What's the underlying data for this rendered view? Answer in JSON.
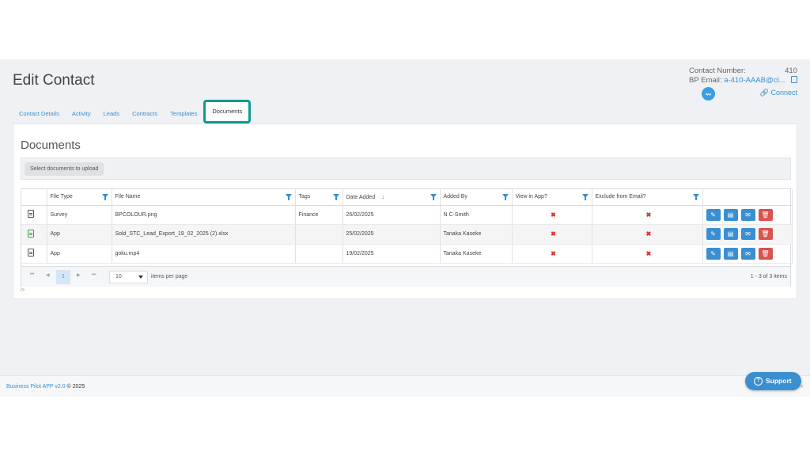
{
  "page": {
    "title": "Edit Contact"
  },
  "contact": {
    "number_label": "Contact Number:",
    "number_value": "410",
    "email_label": "BP Email:",
    "email_value": "a-410-AAAB@cl...",
    "badge": "app",
    "connect_label": "Connect"
  },
  "tabs": [
    {
      "label": "Contact Details"
    },
    {
      "label": "Activity"
    },
    {
      "label": "Leads"
    },
    {
      "label": "Contracts"
    },
    {
      "label": "Templates"
    },
    {
      "label": "Documents",
      "active": true
    }
  ],
  "documents": {
    "title": "Documents",
    "upload_label": "Select documents to upload",
    "columns": [
      "File Type",
      "File Name",
      "Tags",
      "Date Added",
      "Added By",
      "View in App?",
      "Exclude from Email?"
    ],
    "rows": [
      {
        "icon": "file-text-icon",
        "file_type": "Survey",
        "file_name": "BPCOLOUR.png",
        "tags": "Finance",
        "date_added": "26/02/2025",
        "added_by": "N C-Smith",
        "view_in_app": "✖",
        "exclude_from_email": "✖"
      },
      {
        "icon": "excel-file-icon",
        "file_type": "App",
        "file_name": "Sold_STC_Lead_Export_19_02_2025 (2).xlsx",
        "tags": "",
        "date_added": "25/02/2025",
        "added_by": "Tanaka Kaseke",
        "view_in_app": "✖",
        "exclude_from_email": "✖"
      },
      {
        "icon": "file-text-icon",
        "file_type": "App",
        "file_name": "goku.mp4",
        "tags": "",
        "date_added": "19/02/2025",
        "added_by": "Tanaka Kaseke",
        "view_in_app": "✖",
        "exclude_from_email": "✖"
      }
    ],
    "pager": {
      "first": "⏮",
      "prev": "◀",
      "next": "▶",
      "last": "⏭",
      "current_page": "1",
      "page_size": "10",
      "items_per_page_label": "items per page",
      "range_label": "1 - 3 of 3 items"
    },
    "trailing_text": "/>"
  },
  "footer": {
    "app_name": "Business Pilot APP v2.0",
    "copyright": " © 2025"
  },
  "support": {
    "label": "Support",
    "icon": "?"
  },
  "colors": {
    "accent": "#3a8fcf",
    "active_tab_border": "#0f9a8f",
    "delete": "#d9534f"
  }
}
